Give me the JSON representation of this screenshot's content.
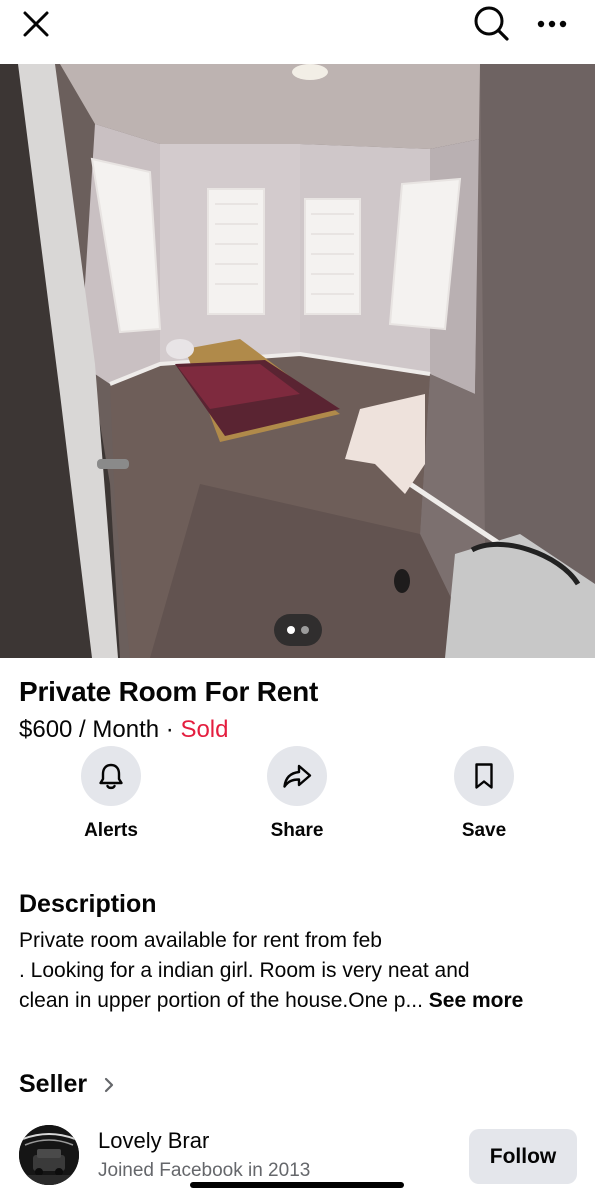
{
  "topbar": {
    "close_icon": "close-icon",
    "search_icon": "search-icon",
    "more_icon": "more-horizontal-icon"
  },
  "photo": {
    "pages_total": 2,
    "current_page": 1
  },
  "listing": {
    "title": "Private Room For Rent",
    "price": "$600 / Month",
    "separator": " · ",
    "status": "Sold",
    "status_color": "#e41e3f"
  },
  "actions": [
    {
      "label": "Alerts",
      "icon": "bell-icon"
    },
    {
      "label": "Share",
      "icon": "share-arrow-icon"
    },
    {
      "label": "Save",
      "icon": "bookmark-icon"
    }
  ],
  "description": {
    "heading": "Description",
    "lines": [
      "Private room available for rent from feb",
      ". Looking for a indian girl. Room is very neat and",
      "clean in upper portion of the house.One p... "
    ],
    "see_more": "See more"
  },
  "seller": {
    "heading": "Seller",
    "chevron_icon": "chevron-right-icon",
    "name": "Lovely Brar",
    "joined": "Joined Facebook in 2013",
    "follow_label": "Follow"
  }
}
